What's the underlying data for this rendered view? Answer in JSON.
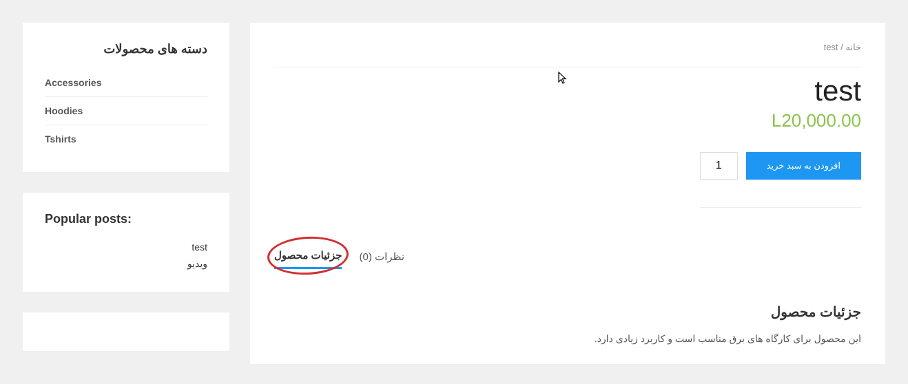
{
  "sidebar": {
    "categories": {
      "title": "دسته های محصولات",
      "items": [
        "Accessories",
        "Hoodies",
        "Tshirts"
      ]
    },
    "popular": {
      "title": "Popular posts:",
      "links": [
        "test",
        "ویدیو"
      ]
    }
  },
  "breadcrumb": {
    "home": "خانه",
    "sep": " / ",
    "current": "test"
  },
  "product": {
    "title": "test",
    "price": "L20,000.00",
    "qty": "1",
    "add_to_cart": "افزودن به سبد خرید"
  },
  "tabs": {
    "details": "جزئیات محصول",
    "reviews": "نظرات (0)"
  },
  "details": {
    "heading": "جزئیات محصول",
    "body": "این محصول برای کارگاه های برق مناسب است و کاربرد زیادی دارد."
  }
}
